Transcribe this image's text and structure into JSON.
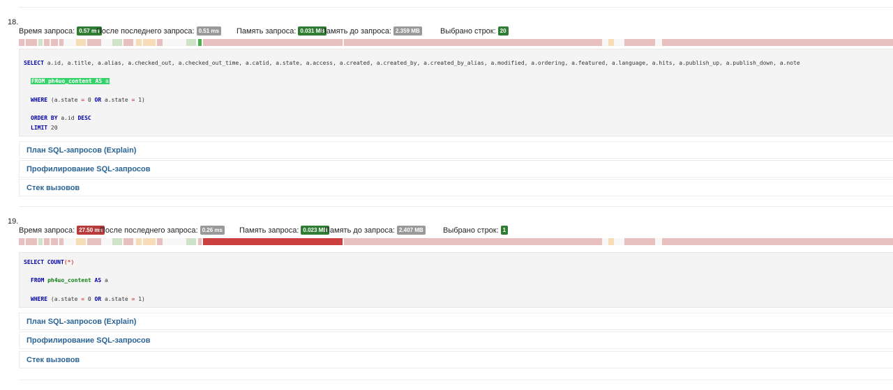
{
  "entries": [
    {
      "number": "18.",
      "query_time_label": "Время запроса:",
      "query_time": "0.57 ms",
      "query_time_color": "#2e7d32",
      "since_last_label": "После последнего запроса:",
      "since_last": "0.51 ms",
      "memory_label": "Память запроса:",
      "memory": "0.031 MB",
      "memory_before_label": "Память до запроса:",
      "memory_before": "2.359 MB",
      "rows_label": "Выбрано строк:",
      "rows": "20",
      "sql": {
        "select_kw": "SELECT",
        "select_cols": " a.id, a.title, a.alias, a.checked_out, a.checked_out_time, a.catid, a.state, a.access, a.created, a.created_by, a.created_by_alias, a.modified, a.ordering, a.featured, a.language, a.hits, a.publish_up, a.publish_down, a.note",
        "from_kw": "FROM",
        "table": "ph4uo_content",
        "as_kw": "AS",
        "alias": "a",
        "where_kw": "WHERE",
        "where_a": " (a.state ",
        "eq": "=",
        "where_b": " 0 ",
        "or_kw": "OR",
        "where_c": " a.state ",
        "where_d": " 1)",
        "order_kw": "ORDER BY",
        "order_col": " a.id ",
        "desc_kw": "DESC",
        "limit_kw": "LIMIT",
        "limit_val": " 20"
      },
      "panels": [
        "План SQL-запросов (Explain)",
        "Профилирование SQL-запросов",
        "Стек вызовов"
      ]
    },
    {
      "number": "19.",
      "query_time_label": "Время запроса:",
      "query_time": "27.50 ms",
      "query_time_color": "#b83a3a",
      "since_last_label": "После последнего запроса:",
      "since_last": "0.26 ms",
      "memory_label": "Память запроса:",
      "memory": "0.023 MB",
      "memory_before_label": "Память до запроса:",
      "memory_before": "2.407 MB",
      "rows_label": "Выбрано строк:",
      "rows": "1",
      "sql": {
        "select_kw": "SELECT",
        "count_kw": "COUNT",
        "count_open": "(",
        "star": "*",
        "count_close": ")",
        "from_kw": "FROM",
        "table": "ph4uo_content",
        "as_kw": "AS",
        "alias": "a",
        "where_kw": "WHERE",
        "where_a": " (a.state ",
        "eq": "=",
        "where_b": " 0 ",
        "or_kw": "OR",
        "where_c": " a.state ",
        "where_d": " 1)"
      },
      "panels": [
        "План SQL-запросов (Explain)",
        "Профилирование SQL-запросов",
        "Стек вызовов"
      ]
    }
  ],
  "colors": {
    "badge_green": "#2e7d32",
    "badge_gray": "#999999",
    "badge_red": "#b83a3a",
    "link_blue": "#2a6496",
    "timeline_red": "#e8c0c0",
    "timeline_green": "#cfe3c9",
    "timeline_orange": "#f7dcb8",
    "timeline_active_green": "#4caf50",
    "timeline_active_red": "#cc3f3f"
  }
}
